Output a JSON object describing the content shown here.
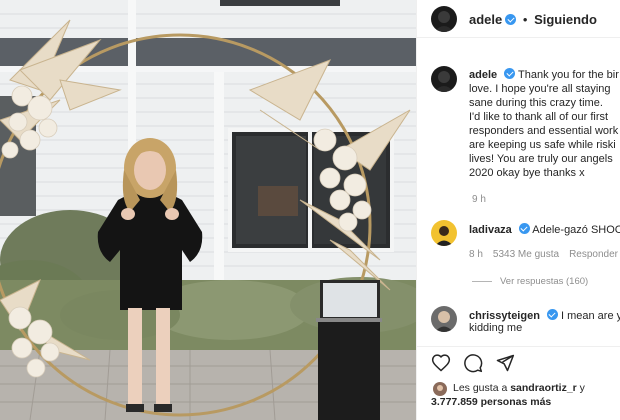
{
  "post": {
    "author": "adele",
    "follow_status": "Siguiendo",
    "separator": "•",
    "caption_lines": [
      "Thank you for the bir",
      "love. I hope you're all staying",
      "sane during this crazy time.",
      "I'd like to thank all of our first",
      "responders and essential work",
      "are keeping us safe while riski",
      "lives! You are truly our angels",
      "2020 okay bye thanks x"
    ],
    "time_ago": "9 h"
  },
  "comments": [
    {
      "user": "ladivaza",
      "text": "Adele-gazó SHOC",
      "time": "8 h",
      "likes": "5343 Me gusta",
      "reply": "Responder",
      "view_replies": "Ver respuestas (160)"
    },
    {
      "user": "chrissyteigen",
      "line1": "I mean are yo",
      "line2": "kidding me"
    }
  ],
  "likes": {
    "prefix": "Les gusta a",
    "first_user": "sandraortiz_r",
    "conjunction": "y",
    "count": "3.777.859 personas más"
  },
  "icons": [
    "heart-icon",
    "comment-icon",
    "share-icon",
    "verified-icon"
  ],
  "colors": {
    "verified": "#3897f0",
    "muted": "#8e8e8e",
    "text": "#262626"
  }
}
